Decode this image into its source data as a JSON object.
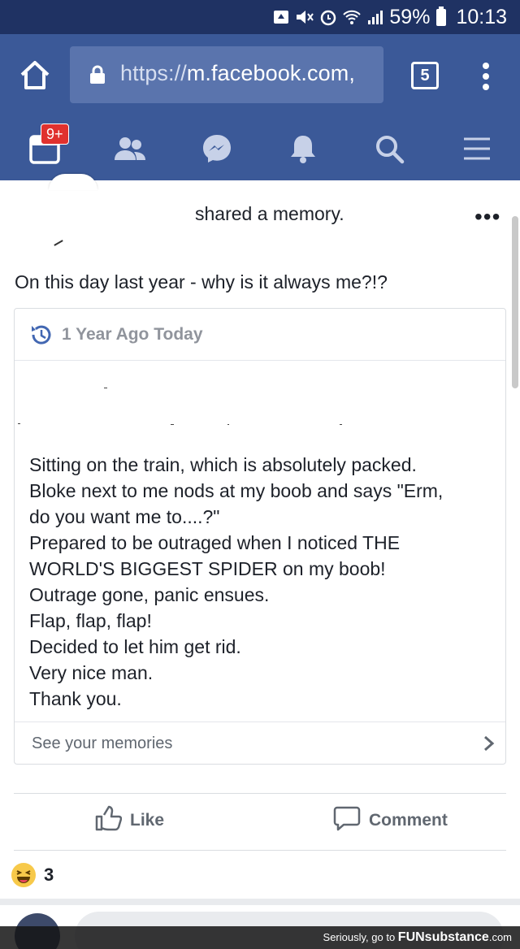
{
  "status_bar": {
    "battery": "59%",
    "time": "10:13"
  },
  "browser": {
    "url_scheme": "https://",
    "url_host": "m.facebook.com,",
    "tab_count": "5"
  },
  "fb_nav": {
    "badge": "9+"
  },
  "post": {
    "shared_text": "shared a memory.",
    "caption": "On this day last year - why is it always me?!?",
    "memory": {
      "header": "1 Year Ago Today",
      "lines": [
        "Sitting on the train, which is absolutely packed.",
        "Bloke next to me nods at my boob and says \"Erm,",
        "do you want me to....?\"",
        "Prepared to be outraged when I noticed THE",
        "WORLD'S BIGGEST SPIDER on my boob!",
        "Outrage gone, panic ensues.",
        "Flap, flap, flap!",
        "Decided to let him get rid.",
        "Very nice man.",
        "Thank you."
      ],
      "footer": "See your memories"
    },
    "actions": {
      "like": "Like",
      "comment": "Comment"
    },
    "reaction_count": "3"
  },
  "watermark": {
    "prefix": "Seriously, go to",
    "brand": "FUNsubstance",
    "suffix": ".com"
  },
  "colors": {
    "fb_blue": "#3b5998",
    "status_bar": "#1f3263",
    "muted": "#90949c"
  },
  "icons": [
    "home-icon",
    "lock-icon",
    "menu-dots-icon",
    "news-feed-icon",
    "friends-icon",
    "messenger-icon",
    "bell-icon",
    "search-icon",
    "hamburger-icon",
    "history-icon",
    "chevron-right-icon",
    "thumbs-up-icon",
    "comment-icon",
    "laughing-emoji-icon"
  ]
}
